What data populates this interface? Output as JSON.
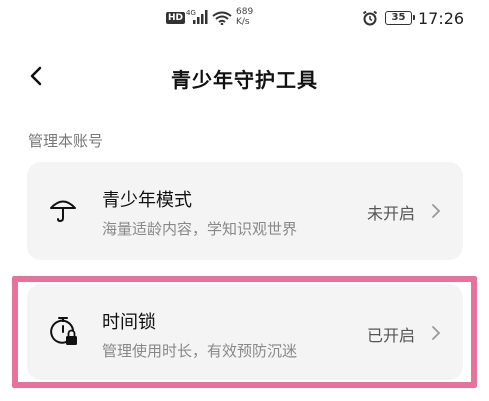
{
  "status_bar": {
    "hd": "HD",
    "network": "4G",
    "speed_value": "689",
    "speed_unit": "K/s",
    "battery": "35",
    "time": "17:26"
  },
  "header": {
    "title": "青少年守护工具"
  },
  "section": {
    "label": "管理本账号"
  },
  "items": [
    {
      "title": "青少年模式",
      "subtitle": "海量适龄内容，学知识观世界",
      "status": "未开启",
      "icon": "umbrella-icon"
    },
    {
      "title": "时间锁",
      "subtitle": "管理使用时长，有效预防沉迷",
      "status": "已开启",
      "icon": "timer-lock-icon"
    }
  ],
  "colors": {
    "highlight": "#e8739a",
    "card_bg": "#f4f4f4"
  }
}
